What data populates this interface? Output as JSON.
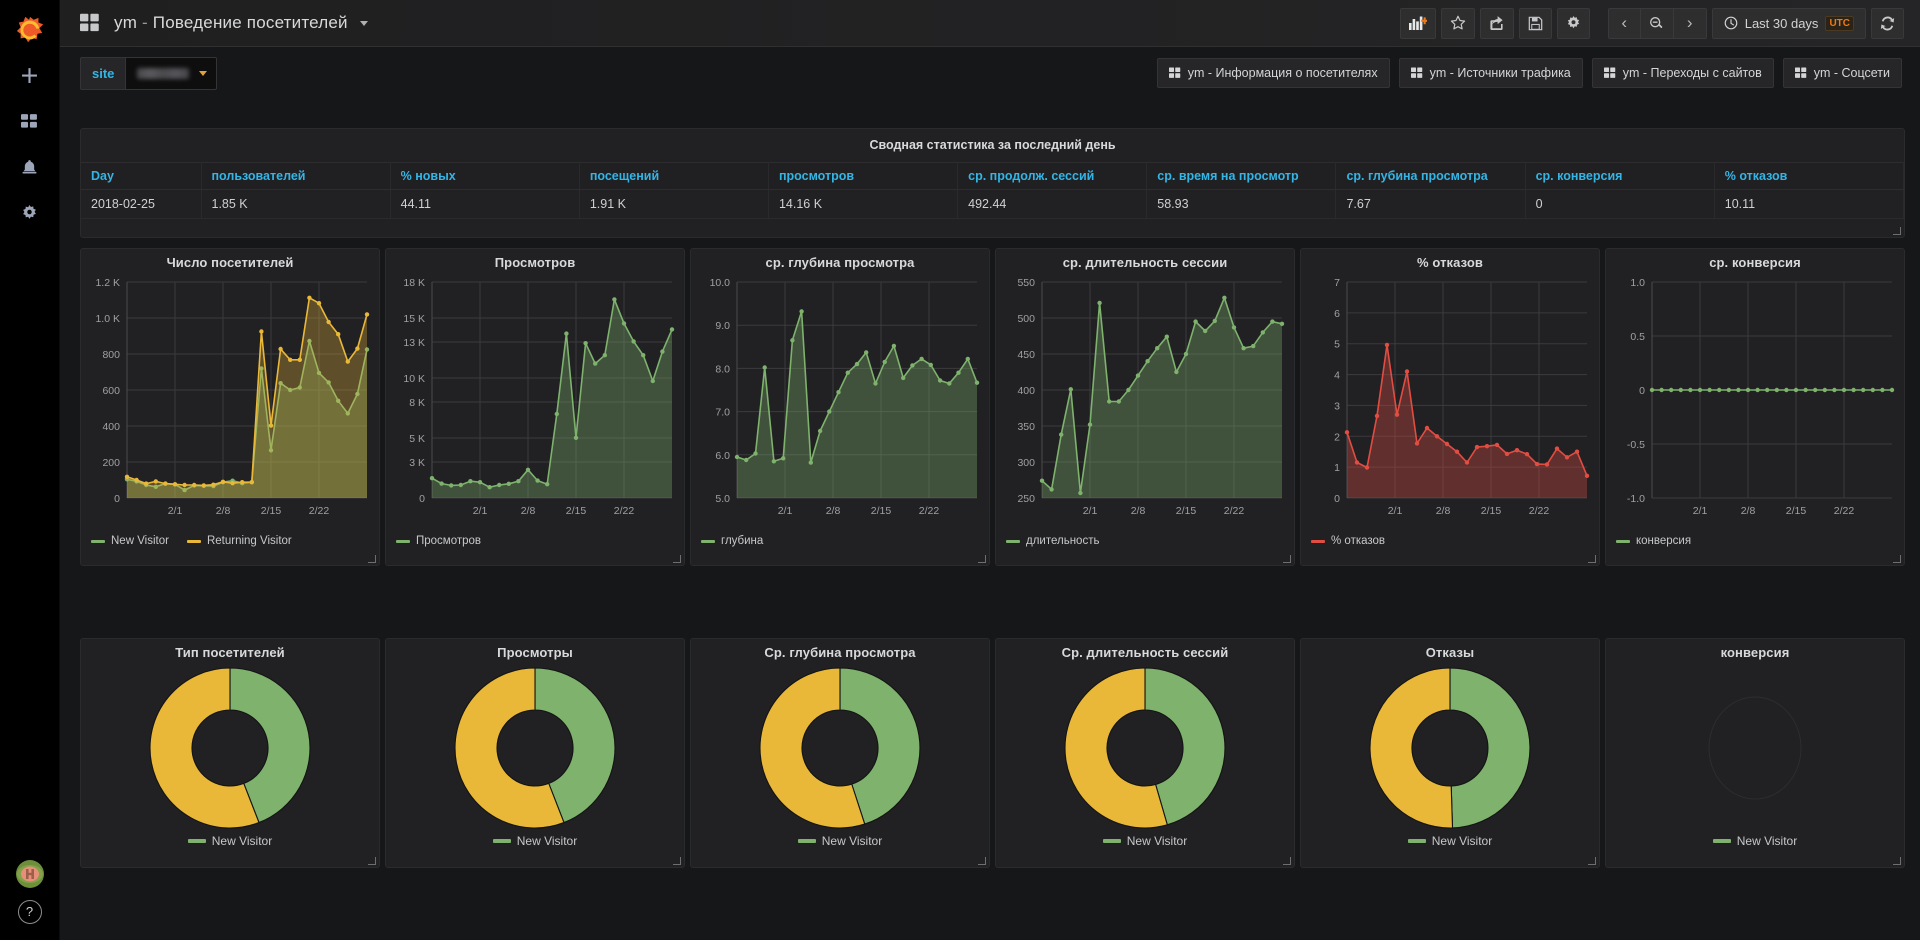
{
  "sidemenu": {
    "logo": "grafana-logo",
    "items": [
      {
        "name": "create-add",
        "icon": "plus-icon"
      },
      {
        "name": "dashboards",
        "icon": "dashboards-icon"
      },
      {
        "name": "alerting",
        "icon": "bell-icon"
      },
      {
        "name": "configuration",
        "icon": "gear-icon"
      }
    ],
    "avatar": "user-avatar",
    "help": "?"
  },
  "navbar": {
    "dash_icon": "dashboard-grid-icon",
    "title_prefix": "ym",
    "title_sep": " - ",
    "title_main": "Поведение посетителей",
    "buttons": [
      {
        "name": "add-panel-button",
        "icon": "add-panel-icon"
      },
      {
        "name": "star-dashboard-button",
        "icon": "star-icon"
      },
      {
        "name": "share-dashboard-button",
        "icon": "share-icon"
      },
      {
        "name": "save-dashboard-button",
        "icon": "save-icon"
      },
      {
        "name": "dashboard-settings-button",
        "icon": "gear-icon"
      }
    ],
    "time_prev": "‹",
    "time_zoomout": "zoom-out-icon",
    "time_next": "›",
    "time_range": "Last 30 days",
    "timezone": "UTC",
    "refresh": "refresh-icon"
  },
  "submenu": {
    "variable": {
      "label": "site",
      "value": "",
      "redacted": true
    },
    "dashlinks": [
      "ym - Информация о посетителях",
      "ym - Источники трафика",
      "ym - Переходы с сайтов",
      "ym - Соцсети"
    ]
  },
  "colors": {
    "green": "#7eb26d",
    "yellow": "#eab839",
    "red": "#e24d42",
    "green_fill": "#3a5a34",
    "red_fill": "#5d2b28",
    "accent_blue": "#33b5e5",
    "orange": "#eb7b18",
    "panel_bg": "#212124",
    "page_bg": "#161719"
  },
  "table_panel": {
    "title": "Сводная статистика за последний день",
    "columns": [
      "Day",
      "пользователей",
      "% новых",
      "посещений",
      "просмотров",
      "ср. продолж. сессий",
      "ср. время на просмотр",
      "ср. глубина просмотра",
      "ср. конверсия",
      "% отказов"
    ],
    "rows": [
      [
        "2018-02-25",
        "1.85 K",
        "44.11",
        "1.91 K",
        "14.16 K",
        "492.44",
        "58.93",
        "7.67",
        "0",
        "10.11"
      ]
    ]
  },
  "chart_data": [
    {
      "type": "area",
      "panel": "visitors-count",
      "title": "Число посетителей",
      "xlabel": "",
      "ylabel": "",
      "ylim": [
        0,
        1200
      ],
      "yticks": [
        0,
        200,
        400,
        600,
        800,
        1000,
        1200
      ],
      "ytick_labels": [
        "0",
        "200",
        "400",
        "600",
        "800",
        "1.0 K",
        "1.2 K"
      ],
      "xticks": [
        "2/1",
        "2/8",
        "2/15",
        "2/22"
      ],
      "grid": true,
      "legend": [
        "New Visitor",
        "Returning Visitor"
      ],
      "legend_position": "bottom-left",
      "series": [
        {
          "name": "New Visitor",
          "color": "#7eb26d",
          "values": [
            104,
            92,
            72,
            62,
            80,
            76,
            44,
            70,
            68,
            66,
            88,
            96,
            82,
            88,
            720,
            265,
            638,
            600,
            614,
            872,
            695,
            642,
            540,
            470,
            578,
            825
          ]
        },
        {
          "name": "Returning Visitor",
          "color": "#eab839",
          "values": [
            118,
            100,
            80,
            92,
            80,
            76,
            72,
            72,
            70,
            74,
            90,
            82,
            88,
            88,
            925,
            402,
            828,
            768,
            768,
            1112,
            1082,
            978,
            910,
            758,
            830,
            1020
          ]
        }
      ]
    },
    {
      "type": "area",
      "panel": "pageviews",
      "title": "Просмотров",
      "ylim": [
        0,
        18000
      ],
      "yticks": [
        0,
        3000,
        5000,
        8000,
        10000,
        13000,
        15000,
        18000
      ],
      "ytick_labels": [
        "0",
        "3 K",
        "5 K",
        "8 K",
        "10 K",
        "13 K",
        "15 K",
        "18 K"
      ],
      "xticks": [
        "2/1",
        "2/8",
        "2/15",
        "2/22"
      ],
      "grid": true,
      "legend": [
        "Просмотров"
      ],
      "series": [
        {
          "name": "Просмотров",
          "color": "#7eb26d",
          "values": [
            1650,
            1200,
            1050,
            1080,
            1400,
            1320,
            900,
            1080,
            1180,
            1400,
            2350,
            1450,
            1150,
            7000,
            13700,
            5020,
            12900,
            11200,
            11900,
            16550,
            14550,
            13050,
            11900,
            9750,
            12200,
            14050
          ]
        }
      ]
    },
    {
      "type": "area",
      "panel": "avg-depth",
      "title": "ср. глубина просмотра",
      "ylim": [
        5.0,
        10.0
      ],
      "yticks": [
        5.0,
        6.0,
        7.0,
        8.0,
        9.0,
        10.0
      ],
      "ytick_labels": [
        "5.0",
        "6.0",
        "7.0",
        "8.0",
        "9.0",
        "10.0"
      ],
      "xticks": [
        "2/1",
        "2/8",
        "2/15",
        "2/22"
      ],
      "grid": true,
      "legend": [
        "глубина"
      ],
      "series": [
        {
          "name": "глубина",
          "color": "#7eb26d",
          "values": [
            5.95,
            5.88,
            6.03,
            8.02,
            5.85,
            5.92,
            8.65,
            9.32,
            5.82,
            6.55,
            7.0,
            7.45,
            7.9,
            8.1,
            8.37,
            7.65,
            8.15,
            8.52,
            7.78,
            8.07,
            8.22,
            8.08,
            7.72,
            7.65,
            7.9,
            8.22,
            7.67
          ]
        }
      ]
    },
    {
      "type": "area",
      "panel": "avg-session-duration",
      "title": "ср. длительность сессии",
      "ylim": [
        250,
        550
      ],
      "yticks": [
        250,
        300,
        350,
        400,
        450,
        500,
        550
      ],
      "ytick_labels": [
        "250",
        "300",
        "350",
        "400",
        "450",
        "500",
        "550"
      ],
      "xticks": [
        "2/1",
        "2/8",
        "2/15",
        "2/22"
      ],
      "grid": true,
      "legend": [
        "длительность"
      ],
      "series": [
        {
          "name": "длительность",
          "color": "#7eb26d",
          "values": [
            274,
            262,
            338,
            401,
            257,
            352,
            521,
            384,
            384,
            400,
            420,
            440,
            458,
            474,
            425,
            450,
            495,
            482,
            496,
            528,
            487,
            458,
            461,
            480,
            495,
            492
          ]
        }
      ]
    },
    {
      "type": "area",
      "panel": "bounce-rate",
      "title": "% отказов",
      "ylim": [
        0,
        7
      ],
      "yticks": [
        0,
        1,
        2,
        3,
        4,
        5,
        6,
        7
      ],
      "ytick_labels": [
        "0",
        "1",
        "2",
        "3",
        "4",
        "5",
        "6",
        "7"
      ],
      "xticks": [
        "2/1",
        "2/8",
        "2/15",
        "2/22"
      ],
      "grid": true,
      "legend": [
        "% отказов"
      ],
      "series": [
        {
          "name": "% отказов",
          "color": "#e24d42",
          "values": [
            2.13,
            1.15,
            0.99,
            2.66,
            4.96,
            2.7,
            4.1,
            1.77,
            2.27,
            2.0,
            1.75,
            1.5,
            1.15,
            1.65,
            1.68,
            1.72,
            1.43,
            1.55,
            1.42,
            1.1,
            1.09,
            1.6,
            1.32,
            1.5,
            0.72
          ]
        }
      ]
    },
    {
      "type": "line",
      "panel": "avg-conversion",
      "title": "ср. конверсия",
      "ylim": [
        -1.0,
        1.0
      ],
      "yticks": [
        -1.0,
        -0.5,
        0,
        0.5,
        1.0
      ],
      "ytick_labels": [
        "-1.0",
        "-0.5",
        "0",
        "0.5",
        "1.0"
      ],
      "xticks": [
        "2/1",
        "2/8",
        "2/15",
        "2/22"
      ],
      "grid": true,
      "legend": [
        "конверсия"
      ],
      "series": [
        {
          "name": "конверсия",
          "color": "#7eb26d",
          "values": [
            0,
            0,
            0,
            0,
            0,
            0,
            0,
            0,
            0,
            0,
            0,
            0,
            0,
            0,
            0,
            0,
            0,
            0,
            0,
            0,
            0,
            0,
            0,
            0,
            0,
            0
          ]
        }
      ]
    },
    {
      "type": "pie",
      "panel": "visitor-type-pie",
      "title": "Тип посетителей",
      "legend": [
        "New Visitor"
      ],
      "slices": [
        {
          "name": "New Visitor",
          "color": "#7eb26d",
          "percent": 44.1
        },
        {
          "name": "Returning Visitor",
          "color": "#eab839",
          "percent": 55.9
        }
      ]
    },
    {
      "type": "pie",
      "panel": "pageviews-pie",
      "title": "Просмотры",
      "legend": [
        "New Visitor"
      ],
      "slices": [
        {
          "name": "New Visitor",
          "color": "#7eb26d",
          "percent": 44.1
        },
        {
          "name": "Returning Visitor",
          "color": "#eab839",
          "percent": 55.9
        }
      ]
    },
    {
      "type": "pie",
      "panel": "avg-depth-pie",
      "title": "Ср. глубина просмотра",
      "legend": [
        "New Visitor"
      ],
      "slices": [
        {
          "name": "New Visitor",
          "color": "#7eb26d",
          "percent": 45.0
        },
        {
          "name": "Returning Visitor",
          "color": "#eab839",
          "percent": 55.0
        }
      ]
    },
    {
      "type": "pie",
      "panel": "avg-session-duration-pie",
      "title": "Ср. длительность сессий",
      "legend": [
        "New Visitor"
      ],
      "slices": [
        {
          "name": "New Visitor",
          "color": "#7eb26d",
          "percent": 45.5
        },
        {
          "name": "Returning Visitor",
          "color": "#eab839",
          "percent": 54.5
        }
      ]
    },
    {
      "type": "pie",
      "panel": "bounces-pie",
      "title": "Отказы",
      "legend": [
        "New Visitor"
      ],
      "slices": [
        {
          "name": "New Visitor",
          "color": "#7eb26d",
          "percent": 49.5
        },
        {
          "name": "Returning Visitor",
          "color": "#eab839",
          "percent": 50.5
        }
      ]
    },
    {
      "type": "pie",
      "panel": "conversion-pie",
      "title": "конверсия",
      "legend": [
        "New Visitor"
      ],
      "slices": []
    }
  ]
}
